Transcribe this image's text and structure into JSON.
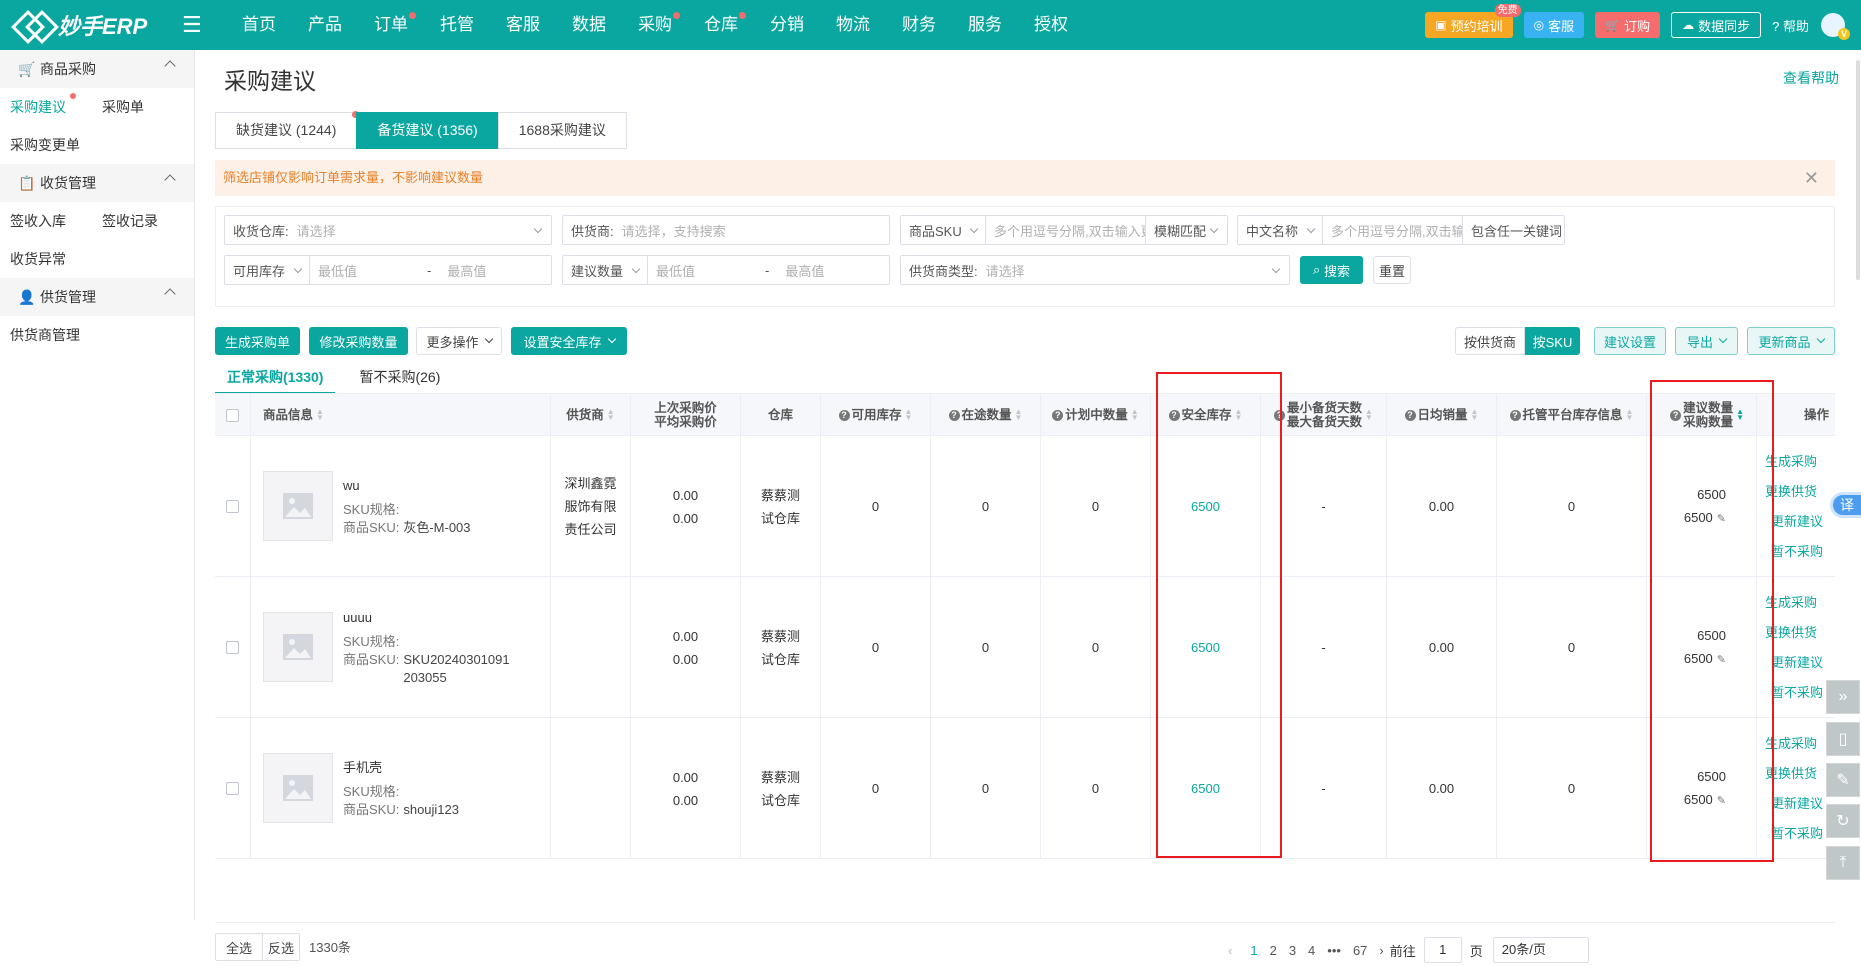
{
  "app": {
    "name": "妙手ERP"
  },
  "nav": [
    "首页",
    "产品",
    "订单",
    "托管",
    "客服",
    "数据",
    "采购",
    "仓库",
    "分销",
    "物流",
    "财务",
    "服务",
    "授权"
  ],
  "nav_dots": [
    false,
    false,
    true,
    false,
    false,
    false,
    true,
    true,
    false,
    false,
    false,
    false,
    false
  ],
  "top_right": {
    "training": "预约培训",
    "free": "免费",
    "service": "客服",
    "order": "订购",
    "sync": "数据同步",
    "help": "帮助"
  },
  "sidebar": {
    "g1": "商品采购",
    "g1_items": [
      "采购建议",
      "采购单",
      "采购变更单"
    ],
    "g2": "收货管理",
    "g2_items": [
      "签收入库",
      "签收记录",
      "收货异常"
    ],
    "g3": "供货管理",
    "g3_items": [
      "供货商管理"
    ]
  },
  "page": {
    "title": "采购建议",
    "help": "查看帮助"
  },
  "tabs": [
    "缺货建议 (1244)",
    "备货建议 (1356)",
    "1688采购建议"
  ],
  "notice": "筛选店铺仅影响订单需求量，不影响建议数量",
  "filters": {
    "warehouse_label": "收货仓库:",
    "warehouse_ph": "请选择",
    "supplier_label": "供货商:",
    "supplier_ph": "请选择，支持搜索",
    "sku_label": "商品SKU",
    "sku_ph": "多个用逗号分隔,双击输入更多",
    "match": "模糊匹配",
    "name_label": "中文名称",
    "name_ph": "多个用逗号分隔,双击输入更多",
    "keyword": "包含任一关键词",
    "stock_label": "可用库存",
    "min_ph": "最低值",
    "max_ph": "最高值",
    "dash": "-",
    "suggest_label": "建议数量",
    "stype_label": "供货商类型:",
    "stype_ph": "请选择",
    "search": "搜索",
    "reset": "重置"
  },
  "actions": {
    "generate": "生成采购单",
    "modify": "修改采购数量",
    "more": "更多操作",
    "safety": "设置安全库存",
    "by_supplier": "按供货商",
    "by_sku": "按SKU",
    "settings": "建议设置",
    "export": "导出",
    "update": "更新商品"
  },
  "subtabs": [
    "正常采购(1330)",
    "暂不采购(26)"
  ],
  "columns": {
    "product": "商品信息",
    "supplier": "供货商",
    "price1": "上次采购价",
    "price2": "平均采购价",
    "warehouse": "仓库",
    "available": "可用库存",
    "transit": "在途数量",
    "planned": "计划中数量",
    "safety": "安全库存",
    "min_days": "最小备货天数",
    "max_days": "最大备货天数",
    "daily": "日均销量",
    "platform": "托管平台库存信息",
    "suggest": "建议数量",
    "purchase": "采购数量",
    "ops": "操作"
  },
  "sku_spec_label": "SKU规格:",
  "sku_label": "商品SKU:",
  "rows": [
    {
      "name": "wu",
      "sku": "灰色-M-003",
      "supplier": "深圳鑫霓服饰有限责任公司",
      "price1": "0.00",
      "price2": "0.00",
      "warehouse": "蔡蔡测试仓库",
      "available": "0",
      "transit": "0",
      "planned": "0",
      "safety": "6500",
      "days": "-",
      "daily": "0.00",
      "platform": "0",
      "suggest": "6500",
      "purchase": "6500"
    },
    {
      "name": "uuuu",
      "sku": "SKU20240301091203055",
      "supplier": "",
      "price1": "0.00",
      "price2": "0.00",
      "warehouse": "蔡蔡测试仓库",
      "available": "0",
      "transit": "0",
      "planned": "0",
      "safety": "6500",
      "days": "-",
      "daily": "0.00",
      "platform": "0",
      "suggest": "6500",
      "purchase": "6500"
    },
    {
      "name": "手机壳",
      "sku": "shouji123",
      "supplier": "",
      "price1": "0.00",
      "price2": "0.00",
      "warehouse": "蔡蔡测试仓库",
      "available": "0",
      "transit": "0",
      "planned": "0",
      "safety": "6500",
      "days": "-",
      "daily": "0.00",
      "platform": "0",
      "suggest": "6500",
      "purchase": "6500"
    }
  ],
  "row_ops": [
    "生成采购",
    "更换供货",
    "更新建议",
    "暂不采购"
  ],
  "footer": {
    "all": "全选",
    "invert": "反选",
    "total": "1330条",
    "pages": [
      "1",
      "2",
      "3",
      "4",
      "•••",
      "67"
    ],
    "goto": "前往",
    "page_val": "1",
    "page_unit": "页",
    "per_page": "20条/页"
  },
  "translate_badge": "译",
  "colors": {
    "primary": "#0aa7a0",
    "dot": "#f56c6c",
    "highlight": "#e81c1c"
  }
}
